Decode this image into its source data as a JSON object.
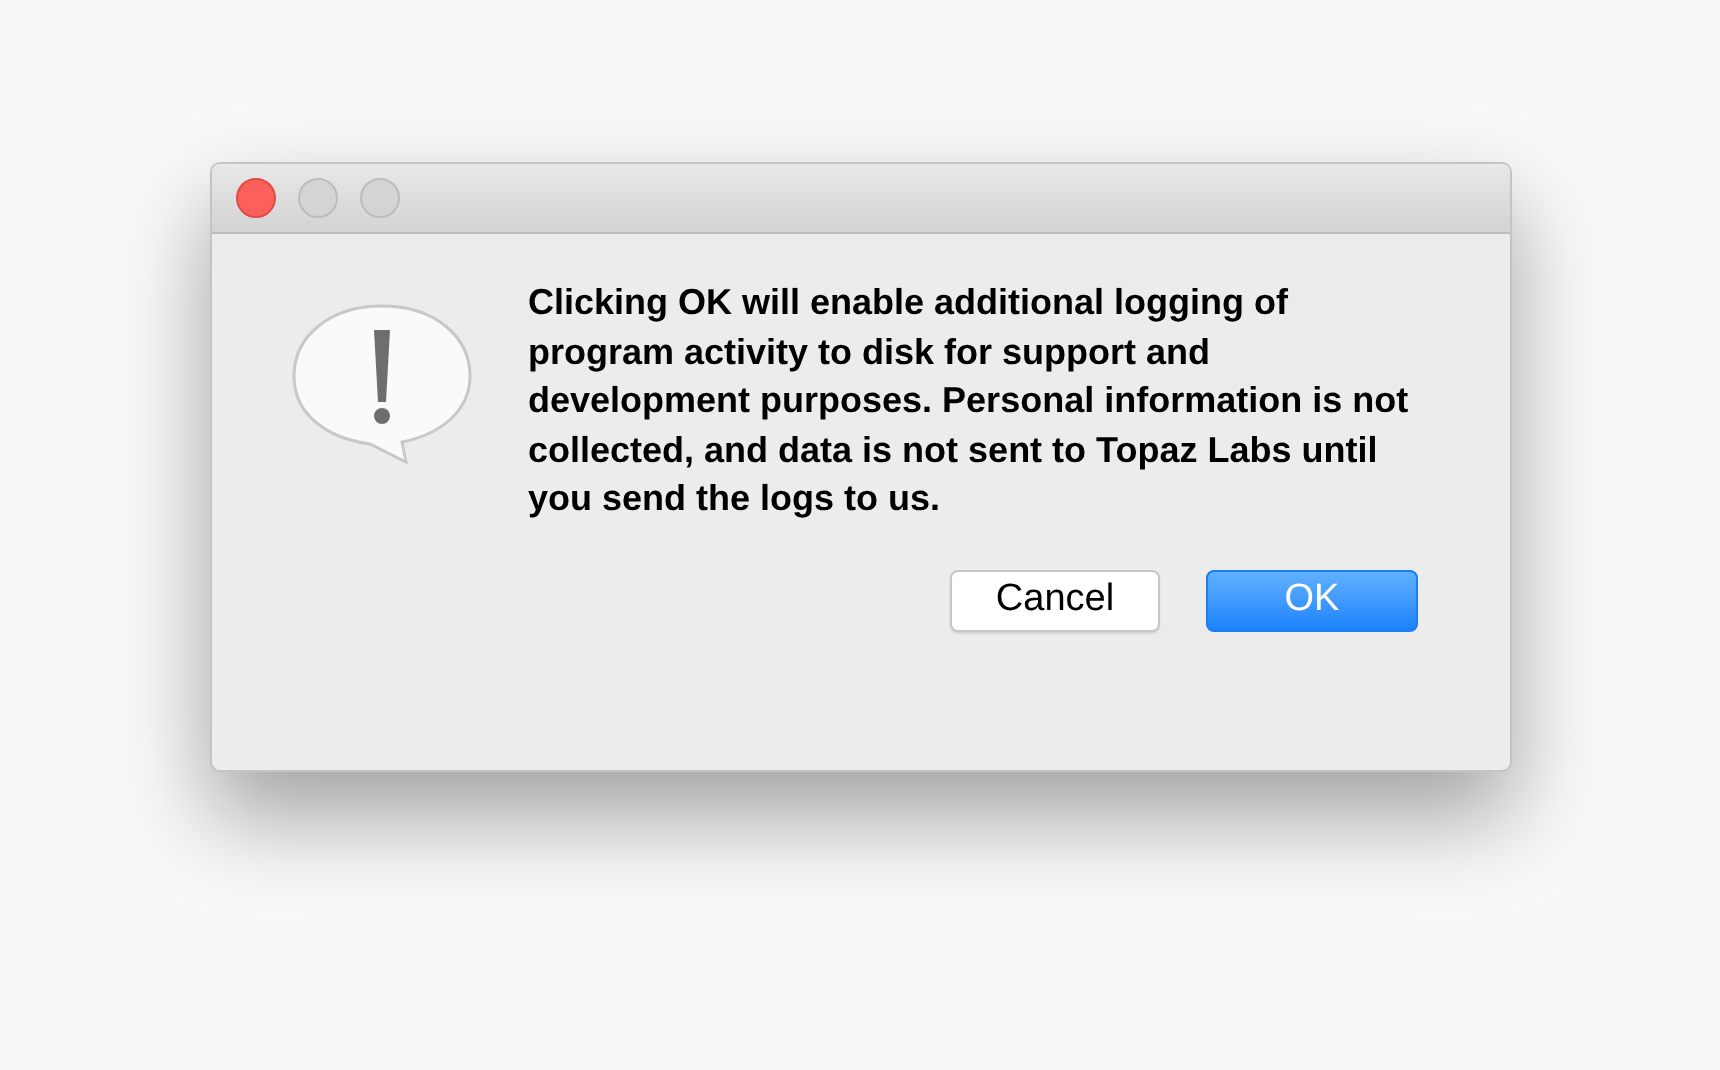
{
  "window": {
    "controls": [
      {
        "kind": "close",
        "disabled": false
      },
      {
        "kind": "minimize",
        "disabled": true
      },
      {
        "kind": "zoom",
        "disabled": true
      }
    ]
  },
  "message": "Clicking OK will enable additional logging of program activity to disk for support and development purposes. Personal information is not collected, and data is not sent to Topaz Labs until you send the logs to us.",
  "buttons": [
    {
      "label": "Cancel",
      "kind": "secondary"
    },
    {
      "label": "OK",
      "kind": "primary"
    }
  ]
}
